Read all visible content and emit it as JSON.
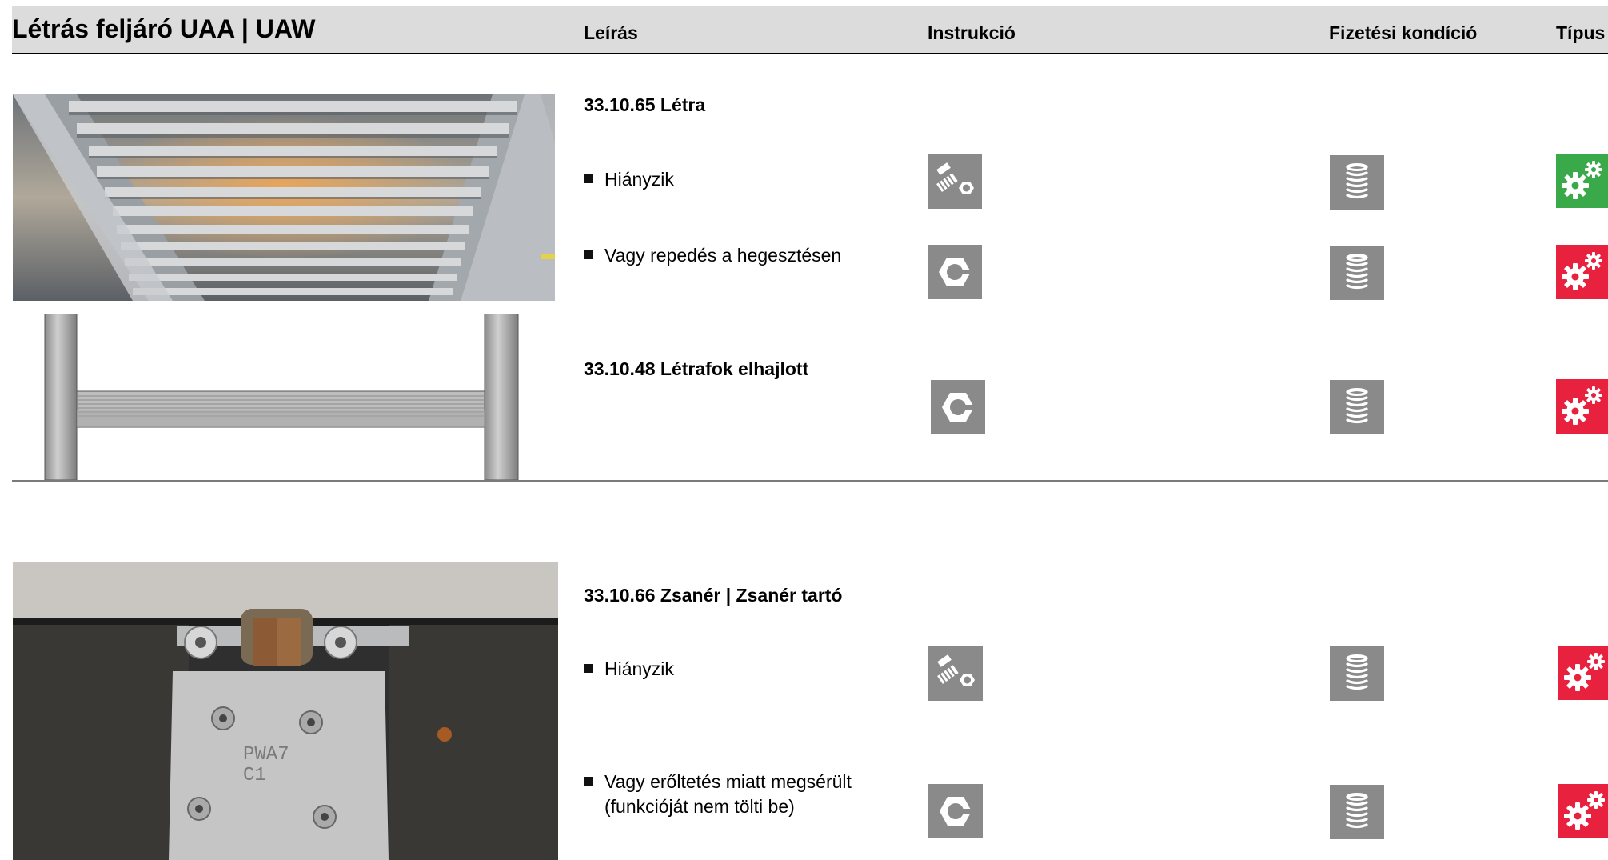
{
  "header": {
    "title": "Létrás feljáró UAA | UAW",
    "columns": {
      "description": "Leírás",
      "instruction": "Instrukció",
      "payment": "Fizetési kondíció",
      "type": "Típus"
    }
  },
  "sections": [
    {
      "items": [
        {
          "heading": "33.10.65 Létra"
        },
        {
          "bullet": "Hiányzik",
          "instruction_icon": "bolt-nut-icon",
          "payment_icon": "coin-stack-icon",
          "type_icon": "gears-icon",
          "type_color": "#3aa94a"
        },
        {
          "bullet": "Vagy repedés a hegesztésen",
          "instruction_icon": "nut-icon",
          "payment_icon": "coin-stack-icon",
          "type_icon": "gears-icon",
          "type_color": "#e8213f"
        },
        {
          "heading": "33.10.48 Létrafok elhajlott",
          "instruction_icon": "nut-icon",
          "payment_icon": "coin-stack-icon",
          "type_icon": "gears-icon",
          "type_color": "#e8213f"
        }
      ]
    },
    {
      "items": [
        {
          "heading": "33.10.66 Zsanér | Zsanér tartó"
        },
        {
          "bullet": "Hiányzik",
          "instruction_icon": "bolt-nut-icon",
          "payment_icon": "coin-stack-icon",
          "type_icon": "gears-icon",
          "type_color": "#e8213f"
        },
        {
          "bullet_lines": [
            "Vagy erőltetés miatt megsérült",
            "(funkcióját nem tölti be)"
          ],
          "instruction_icon": "nut-icon",
          "payment_icon": "coin-stack-icon",
          "type_icon": "gears-icon",
          "type_color": "#e8213f"
        }
      ]
    }
  ],
  "photos": {
    "hinge_stamp": [
      "PWA7",
      "C1"
    ]
  }
}
